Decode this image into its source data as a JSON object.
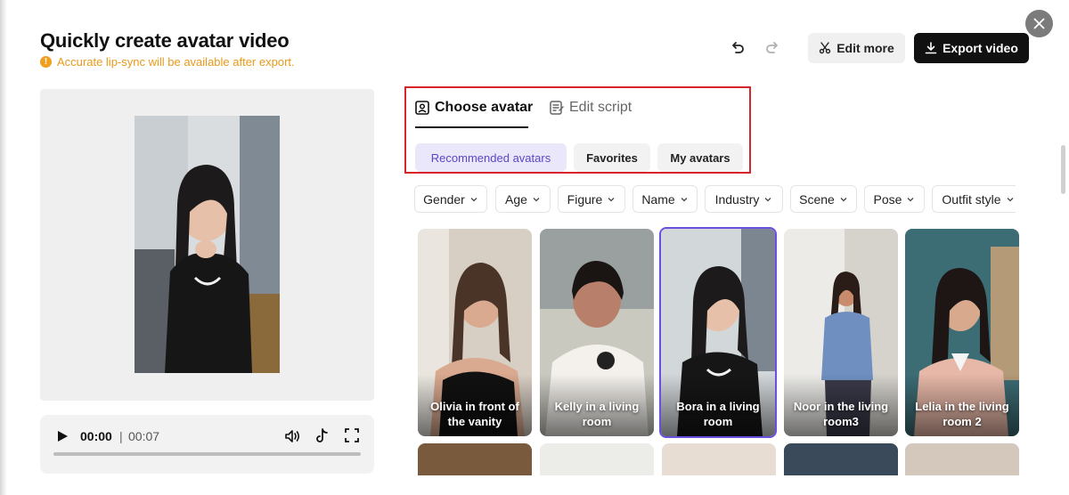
{
  "header": {
    "title": "Quickly create avatar video",
    "warning": "Accurate lip-sync will be available after export.",
    "edit_more": "Edit more",
    "export_video": "Export video"
  },
  "player": {
    "current_time": "00:00",
    "separator": "|",
    "total_time": "00:07",
    "progress": 0
  },
  "tabs": {
    "choose_avatar": "Choose avatar",
    "edit_script": "Edit script"
  },
  "subtabs": {
    "recommended": "Recommended avatars",
    "favorites": "Favorites",
    "my_avatars": "My avatars"
  },
  "filters": [
    "Gender",
    "Age",
    "Figure",
    "Name",
    "Industry",
    "Scene",
    "Pose",
    "Outfit style"
  ],
  "avatars": [
    "Olivia in front of the vanity",
    "Kelly in a living room",
    "Bora in a living room",
    "Noor in the living room3",
    "Lelia in the living room 2"
  ],
  "selected_avatar": "Bora in a living room",
  "colors": {
    "accent": "#5b46c8",
    "warning": "#e89a1a",
    "highlight_border": "#d6262b"
  }
}
